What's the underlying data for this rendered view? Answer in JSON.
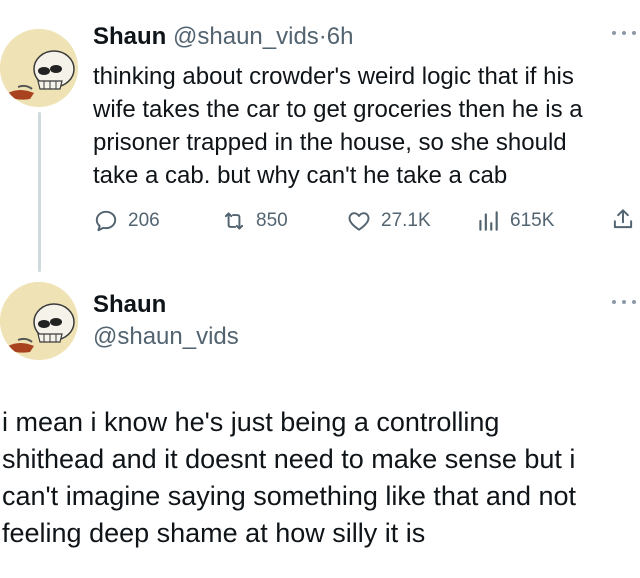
{
  "tweet1": {
    "name": "Shaun",
    "handle": "@shaun_vids",
    "separator": "·",
    "time": "6h",
    "text": "thinking about crowder's weird logic that if his\nwife takes the car to get groceries then he is a\nprisoner trapped in the house, so she should\ntake a cab. but why can't he take a cab",
    "actions": {
      "replies": "206",
      "reposts": "850",
      "likes": "27.1K",
      "views": "615K"
    }
  },
  "tweet2": {
    "name": "Shaun",
    "handle": "@shaun_vids",
    "text": "i mean i know he's just being a controlling\nshithead and it doesnt need to make sense but i\ncan't imagine saying something like that and not\nfeeling deep shame at how silly it is"
  },
  "icons": {
    "reply": "speech-bubble-icon",
    "repost": "repost-arrows-icon",
    "like": "heart-icon",
    "views": "bar-chart-icon",
    "share": "share-upload-icon",
    "more": "more-dots-icon"
  },
  "colors": {
    "text": "#0f1419",
    "secondary": "#536471",
    "accent": "#1d9bf0",
    "avatar_bg": "#efe3b6"
  }
}
